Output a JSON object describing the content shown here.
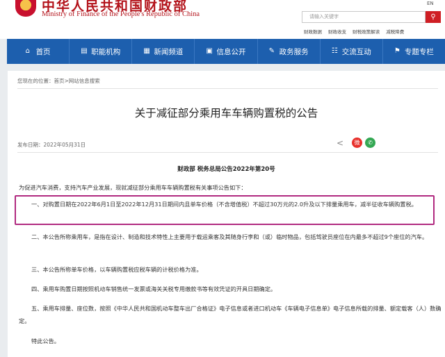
{
  "header": {
    "title_cn": "中华人民共和国财政部",
    "title_en": "Ministry of Finance of the People's Republic of China",
    "search_placeholder": "请输入关键字",
    "lang": "EN",
    "links": [
      "财政数据",
      "财政收支",
      "财税政策解读",
      "减税降费"
    ]
  },
  "nav": [
    {
      "icon": "home-icon",
      "glyph": "⌂",
      "label": "首页"
    },
    {
      "icon": "building-icon",
      "glyph": "▤",
      "label": "职能机构"
    },
    {
      "icon": "newspaper-icon",
      "glyph": "▦",
      "label": "新闻频道"
    },
    {
      "icon": "document-icon",
      "glyph": "▣",
      "label": "信息公开"
    },
    {
      "icon": "service-icon",
      "glyph": "✎",
      "label": "政务服务"
    },
    {
      "icon": "chat-icon",
      "glyph": "☷",
      "label": "交流互动"
    },
    {
      "icon": "pin-icon",
      "glyph": "⚑",
      "label": "专题专栏"
    }
  ],
  "breadcrumb": "您现在的位置：首页>网站信息搜索",
  "article": {
    "title": "关于减征部分乘用车车辆购置税的公告",
    "pubdate": "发布日期：2022年05月31日",
    "doc_number": "财政部  税务总局公告2022年第20号",
    "paragraphs": [
      "为促进汽车消费，支持汽车产业发展，现就减征部分乘用车车辆购置税有关事项公告如下：",
      "一、对购置日期在2022年6月1日至2022年12月31日期间内且单车价格（不含增值税）不超过30万元的2.0升及以下排量乘用车，减半征收车辆购置税。",
      "二、本公告所称乘用车，是指在设计、制造和技术特性上主要用于载运乘客及其随身行李和（或）临时物品，包括驾驶员座位在内最多不超过9个座位的汽车。",
      "三、本公告所称单车价格，以车辆购置税应税车辆的计税价格为准。",
      "四、乘用车购置日期按照机动车销售统一发票或海关关税专用缴款书等有效凭证的开具日期确定。",
      "五、乘用车排量、座位数，按照《中华人民共和国机动车整车出厂合格证》电子信息或者进口机动车《车辆电子信息单》电子信息所载的排量、额定载客（人）数确定。",
      "特此公告。"
    ]
  },
  "colors": {
    "brand_red": "#b3121a",
    "nav_blue": "#1d5fae",
    "highlight": "#b0297f"
  }
}
